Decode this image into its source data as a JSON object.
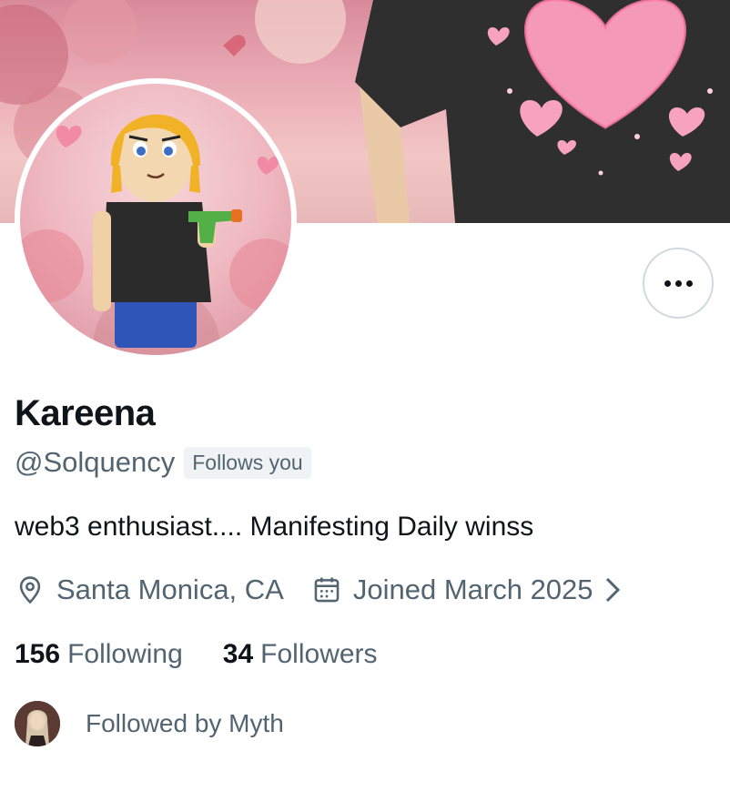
{
  "profile": {
    "display_name": "Kareena",
    "handle": "@Solquency",
    "follows_you_badge": "Follows you",
    "bio": "web3 enthusiast.... Manifesting Daily winss",
    "location": "Santa Monica, CA",
    "joined": "Joined March 2025",
    "following_count": "156",
    "following_label": "Following",
    "followers_count": "34",
    "followers_label": "Followers",
    "followed_by": "Followed by Myth"
  },
  "icons": {
    "more": "more-horizontal-icon",
    "location": "location-pin-icon",
    "calendar": "calendar-icon",
    "chevron": "chevron-right-icon"
  },
  "colors": {
    "text_primary": "#0f1419",
    "text_secondary": "#536471",
    "border": "#cfd9de",
    "badge_bg": "#eff3f4"
  }
}
